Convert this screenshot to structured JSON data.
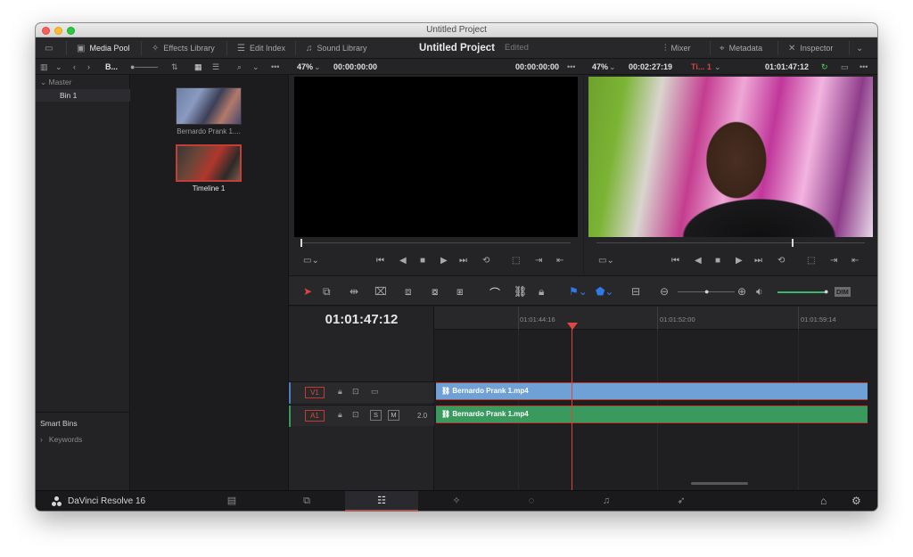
{
  "window": {
    "title": "Untitled Project"
  },
  "topbar": {
    "media_pool": "Media Pool",
    "effects_library": "Effects Library",
    "edit_index": "Edit Index",
    "sound_library": "Sound Library",
    "project_title": "Untitled Project",
    "project_status": "Edited",
    "mixer": "Mixer",
    "metadata": "Metadata",
    "inspector": "Inspector"
  },
  "subbar": {
    "bin_short": "B...",
    "source_zoom": "47%",
    "source_timecode": "00:00:00:00",
    "source_duration": "00:00:00:00",
    "program_zoom": "47%",
    "program_duration": "00:02:27:19",
    "timeline_short": "Ti... 1",
    "program_timecode": "01:01:47:12"
  },
  "left_panel": {
    "master": "Master",
    "bin": "Bin 1",
    "smart_bins": "Smart Bins",
    "keywords": "Keywords"
  },
  "media_pool": {
    "clips": [
      {
        "label": "Bernardo Prank 1...."
      },
      {
        "label": "Timeline 1"
      }
    ]
  },
  "timeline": {
    "timecode": "01:01:47:12",
    "ruler": [
      "01:01:44:16",
      "01:01:52:00",
      "01:01:59:14"
    ],
    "tracks": [
      {
        "name": "V1",
        "clip": "Bernardo Prank 1.mp4"
      },
      {
        "name": "A1",
        "level": "2.0",
        "clip": "Bernardo Prank 1.mp4"
      }
    ],
    "dim_label": "DIM"
  },
  "bottom": {
    "app_name": "DaVinci Resolve 16"
  },
  "icons": {
    "accent": "#d9463c",
    "video_clip": "#6fa0d6",
    "audio_clip": "#3a9a5e"
  }
}
